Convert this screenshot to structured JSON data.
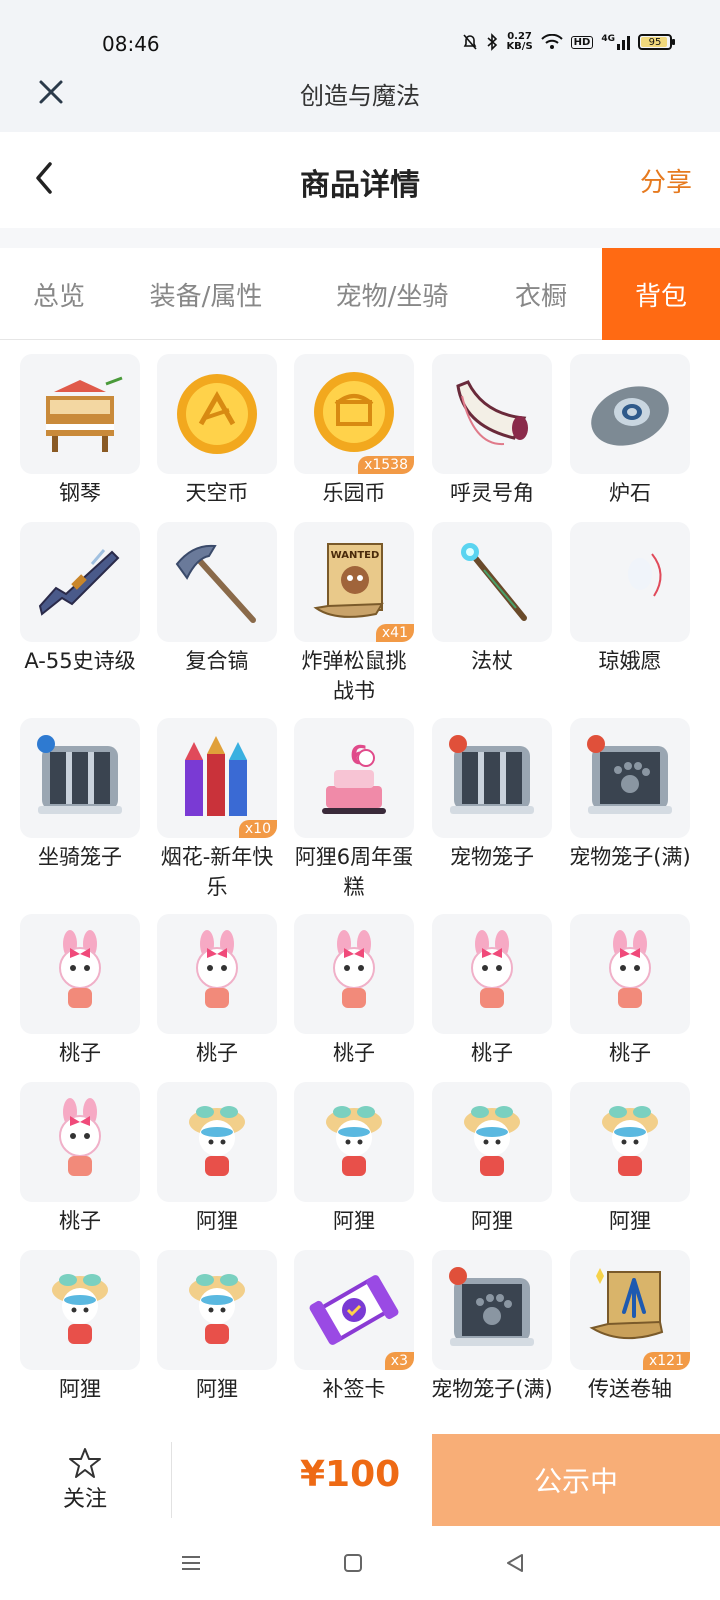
{
  "status": {
    "time": "08:46",
    "speed_value": "0.27",
    "speed_unit": "KB/S",
    "battery": "95",
    "hd": "HD",
    "net": "4G"
  },
  "appbar": {
    "title": "创造与魔法"
  },
  "navbar": {
    "title": "商品详情",
    "share_label": "分享"
  },
  "tabs": [
    {
      "label": "总览"
    },
    {
      "label": "装备/属性"
    },
    {
      "label": "宠物/坐骑"
    },
    {
      "label": "衣橱"
    },
    {
      "label": "背包"
    }
  ],
  "active_tab": "背包",
  "items": [
    {
      "label": "钢琴",
      "icon": "piano-icon",
      "count": ""
    },
    {
      "label": "天空币",
      "icon": "sky-coin-icon",
      "count": ""
    },
    {
      "label": "乐园币",
      "icon": "park-coin-icon",
      "count": "x1538"
    },
    {
      "label": "呼灵号角",
      "icon": "horn-icon",
      "count": ""
    },
    {
      "label": "炉石",
      "icon": "hearthstone-icon",
      "count": ""
    },
    {
      "label": "A-55史诗级",
      "icon": "rifle-icon",
      "count": ""
    },
    {
      "label": "复合镐",
      "icon": "pickaxe-icon",
      "count": ""
    },
    {
      "label": "炸弹松鼠挑战书",
      "icon": "wanted-scroll-icon",
      "count": "x41"
    },
    {
      "label": "法杖",
      "icon": "staff-icon",
      "count": ""
    },
    {
      "label": "琼娥愿",
      "icon": "moon-wish-icon",
      "count": ""
    },
    {
      "label": "坐骑笼子",
      "icon": "mount-cage-icon",
      "count": ""
    },
    {
      "label": "烟花-新年快乐",
      "icon": "fireworks-icon",
      "count": "x10"
    },
    {
      "label": "阿狸6周年蛋糕",
      "icon": "cake-icon",
      "count": ""
    },
    {
      "label": "宠物笼子",
      "icon": "pet-cage-icon",
      "count": ""
    },
    {
      "label": "宠物笼子(满)",
      "icon": "pet-cage-full-icon",
      "count": ""
    },
    {
      "label": "桃子",
      "icon": "peach-bunny-icon",
      "count": ""
    },
    {
      "label": "桃子",
      "icon": "peach-bunny-icon",
      "count": ""
    },
    {
      "label": "桃子",
      "icon": "peach-bunny-icon",
      "count": ""
    },
    {
      "label": "桃子",
      "icon": "peach-bunny-icon",
      "count": ""
    },
    {
      "label": "桃子",
      "icon": "peach-bunny-icon",
      "count": ""
    },
    {
      "label": "桃子",
      "icon": "peach-bunny-icon",
      "count": ""
    },
    {
      "label": "阿狸",
      "icon": "ahri-fox-icon",
      "count": ""
    },
    {
      "label": "阿狸",
      "icon": "ahri-fox-icon",
      "count": ""
    },
    {
      "label": "阿狸",
      "icon": "ahri-fox-icon",
      "count": ""
    },
    {
      "label": "阿狸",
      "icon": "ahri-fox-icon",
      "count": ""
    },
    {
      "label": "阿狸",
      "icon": "ahri-fox-icon",
      "count": ""
    },
    {
      "label": "阿狸",
      "icon": "ahri-fox-icon",
      "count": ""
    },
    {
      "label": "补签卡",
      "icon": "signin-card-icon",
      "count": "x3"
    },
    {
      "label": "宠物笼子(满)",
      "icon": "pet-cage-full-icon",
      "count": ""
    },
    {
      "label": "传送卷轴",
      "icon": "teleport-scroll-icon",
      "count": "x121"
    }
  ],
  "bottom": {
    "follow_label": "关注",
    "price": "¥100",
    "status_button": "公示中"
  },
  "colors": {
    "accent": "#ff6a13",
    "price": "#ee6a14",
    "button": "#f8ae77",
    "share": "#e67a1f"
  }
}
